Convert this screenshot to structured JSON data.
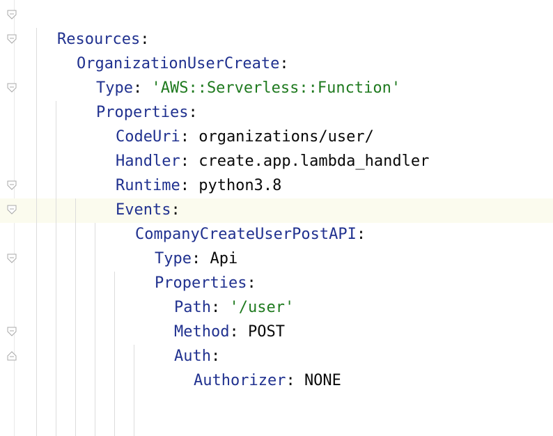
{
  "code_lines": [
    {
      "key": "Resources",
      "sep": ":",
      "value": "",
      "value_type": "none"
    },
    {
      "key": "OrganizationUserCreate",
      "sep": ":",
      "value": "",
      "value_type": "none"
    },
    {
      "key": "Type",
      "sep": ": ",
      "value": "'AWS::Serverless::Function'",
      "value_type": "string"
    },
    {
      "key": "Properties",
      "sep": ":",
      "value": "",
      "value_type": "none"
    },
    {
      "key": "CodeUri",
      "sep": ": ",
      "value": "organizations/user/",
      "value_type": "plain"
    },
    {
      "key": "Handler",
      "sep": ": ",
      "value": "create.app.lambda_handler",
      "value_type": "plain"
    },
    {
      "key": "Runtime",
      "sep": ": ",
      "value": "python3.8",
      "value_type": "plain"
    },
    {
      "key": "Events",
      "sep": ":",
      "value": "",
      "value_type": "none"
    },
    {
      "key": "CompanyCreateUserPostAPI",
      "sep": ":",
      "value": "",
      "value_type": "none"
    },
    {
      "key": "Type",
      "sep": ": ",
      "value": "Api",
      "value_type": "plain"
    },
    {
      "key": "Properties",
      "sep": ":",
      "value": "",
      "value_type": "none"
    },
    {
      "key": "Path",
      "sep": ": ",
      "value": "'/user'",
      "value_type": "string"
    },
    {
      "key": "Method",
      "sep": ": ",
      "value": "POST",
      "value_type": "plain"
    },
    {
      "key": "Auth",
      "sep": ":",
      "value": "",
      "value_type": "none"
    },
    {
      "key": "Authorizer",
      "sep": ": ",
      "value": "NONE",
      "value_type": "plain"
    }
  ],
  "colors": {
    "key": "#20318f",
    "string": "#1f7a1f",
    "plain": "#080808",
    "current_line": "#fbfbee",
    "indent_guide": "#dcdcdc"
  }
}
